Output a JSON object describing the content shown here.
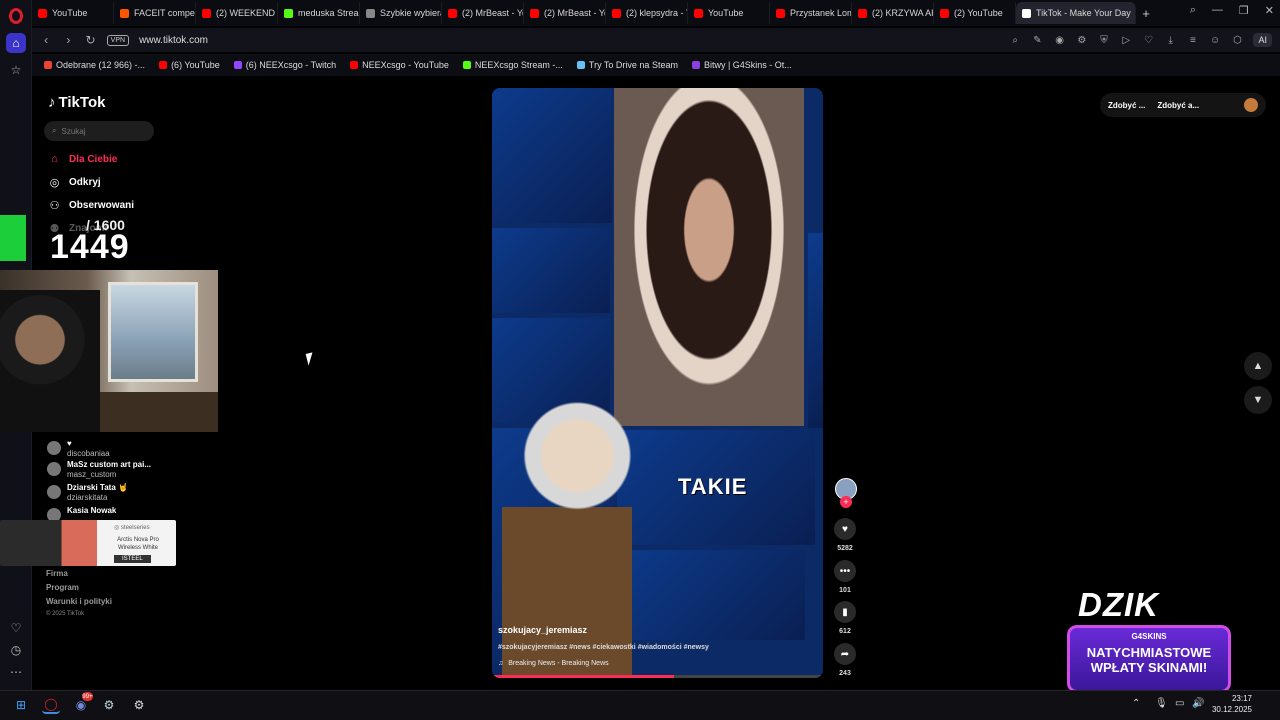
{
  "browser": {
    "tabs": [
      {
        "label": "YouTube",
        "color": "#ff0000"
      },
      {
        "label": "FACEIT competiti",
        "color": "#ff5500"
      },
      {
        "label": "(2) WEEKEND - H",
        "color": "#ff0000"
      },
      {
        "label": "meduska Stream",
        "color": "#53fc18"
      },
      {
        "label": "Szybkie wybieran",
        "color": "#888888"
      },
      {
        "label": "(2) MrBeast - You",
        "color": "#ff0000"
      },
      {
        "label": "(2) MrBeast - You",
        "color": "#ff0000"
      },
      {
        "label": "(2) klepsydra - Yo",
        "color": "#ff0000"
      },
      {
        "label": "YouTube",
        "color": "#ff0000"
      },
      {
        "label": "Przystanek Lomb",
        "color": "#ff0000"
      },
      {
        "label": "(2) KRZYWA AKCJ",
        "color": "#ff0000"
      },
      {
        "label": "(2) YouTube",
        "color": "#ff0000"
      },
      {
        "label": "TikTok - Make Your Day",
        "color": "#ffffff",
        "active": true
      }
    ],
    "new_tab": "+",
    "url": "www.tiktok.com",
    "vpn_label": "VPN",
    "ai_label": "AI",
    "bookmarks": [
      {
        "label": "Odebrane (12 966) -...",
        "color": "#ea4335"
      },
      {
        "label": "(6) YouTube",
        "color": "#ff0000"
      },
      {
        "label": "(6) NEEXcsgo - Twitch",
        "color": "#9146ff"
      },
      {
        "label": "NEEXcsgo - YouTube",
        "color": "#ff0000"
      },
      {
        "label": "NEEXcsgo Stream -...",
        "color": "#53fc18"
      },
      {
        "label": "Try To Drive na Steam",
        "color": "#66c0f4"
      },
      {
        "label": "Bitwy | G4Skins - Ot...",
        "color": "#8b3fe0"
      }
    ]
  },
  "tiktok": {
    "logo": "TikTok",
    "search_placeholder": "Szukaj",
    "nav": [
      {
        "label": "Dla Ciebie",
        "icon": "home-icon",
        "active": true
      },
      {
        "label": "Odkryj",
        "icon": "compass-icon"
      },
      {
        "label": "Obserwowani",
        "icon": "following-icon"
      },
      {
        "label": "Znajomi",
        "icon": "friends-icon"
      }
    ],
    "following": [
      {
        "name": "♥",
        "user": "discobaniaa"
      },
      {
        "name": "MaSz custom art pai...",
        "user": "masz_custom"
      },
      {
        "name": "Dziarski Tata 🤘",
        "user": "dziarskitata"
      },
      {
        "name": "Kasia Nowak",
        "user": ""
      }
    ],
    "footer": [
      "Firma",
      "Program",
      "Warunki i polityki"
    ],
    "copyright": "© 2025 TikTok",
    "get_buttons": [
      "Zdobyć ...",
      "Zdobyć a..."
    ],
    "video": {
      "caption_overlay": "TAKIE",
      "author": "szokujacy_jeremiasz",
      "tags": "#szokujacyjeremiasz #news #ciekawostki #wiadomości #newsy",
      "music": "Breaking News - Breaking News",
      "progress": 0.55
    },
    "actions": {
      "likes": "5282",
      "comments": "101",
      "saves": "612",
      "shares": "243"
    }
  },
  "overlays": {
    "counter_top": "/ 1600",
    "counter_big": "1449",
    "steelseries_brand": "◎ steelseries",
    "steelseries_product": "Arctis Nova Pro Wireless White",
    "steelseries_code": "ISTEEL",
    "dzik_brand": "DZIK",
    "dzik_partner": "G4SKINS",
    "dzik_line1": "NATYCHMIASTOWE",
    "dzik_line2": "WPŁATY SKINAMI!"
  },
  "taskbar": {
    "time": "23:17",
    "date": "30.12.2025",
    "discord_badge": "99+"
  }
}
